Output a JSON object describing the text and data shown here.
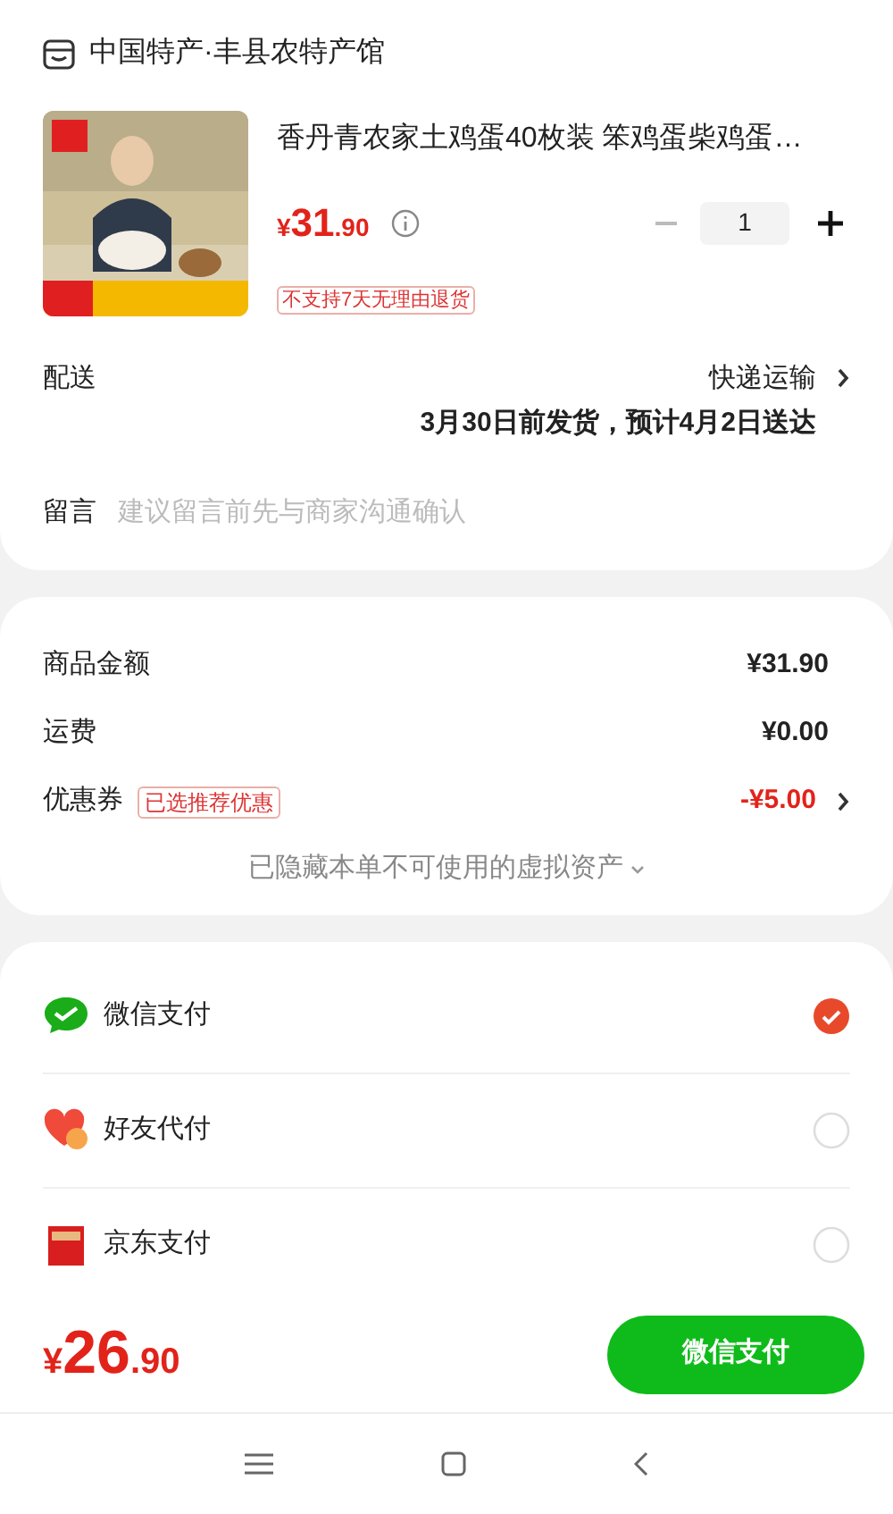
{
  "store": {
    "name": "中国特产·丰县农特产馆"
  },
  "product": {
    "title": "香丹青农家土鸡蛋40枚装 笨鸡蛋柴鸡蛋…",
    "price": {
      "symbol": "¥",
      "integer": "31",
      "decimal": ".90"
    },
    "quantity": "1",
    "tag": "不支持7天无理由退货"
  },
  "delivery": {
    "label": "配送",
    "method": "快递运输",
    "estimate": "3月30日前发货，预计4月2日送达"
  },
  "note": {
    "label": "留言",
    "placeholder": "建议留言前先与商家沟通确认"
  },
  "summary": [
    {
      "kind": "plain",
      "label": "商品金额",
      "value": "¥31.90"
    },
    {
      "kind": "plain",
      "label": "运费",
      "value": "¥0.00"
    },
    {
      "kind": "coupon",
      "label": "优惠券",
      "tag": "已选推荐优惠",
      "value": "-¥5.00"
    }
  ],
  "hidden_assets_note": "已隐藏本单不可使用的虚拟资产",
  "payments": [
    {
      "kind": "wechat",
      "name": "微信支付",
      "selected": true
    },
    {
      "kind": "friend",
      "name": "好友代付",
      "selected": false
    },
    {
      "kind": "card",
      "name": "京东支付",
      "selected": false
    }
  ],
  "footer": {
    "total": {
      "symbol": "¥",
      "integer": "26",
      "decimal": ".90"
    },
    "pay_button": "微信支付"
  }
}
